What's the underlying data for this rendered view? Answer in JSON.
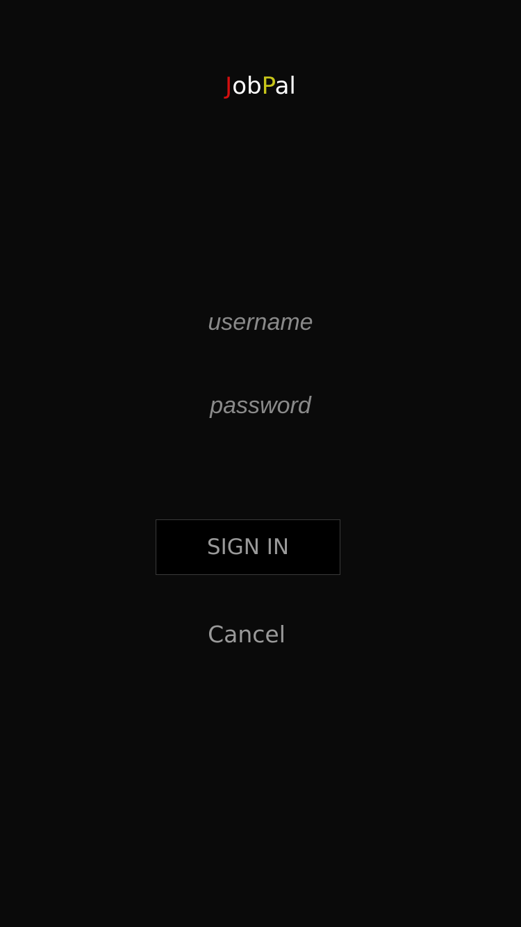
{
  "logo": {
    "letter_j": "J",
    "part_ob": "ob",
    "letter_p": "P",
    "part_al": "al",
    "colors": {
      "j": "#d40f0f",
      "p": "#c7c51a",
      "rest": "#ffffff"
    }
  },
  "form": {
    "username_placeholder": "username",
    "username_value": "",
    "password_placeholder": "password",
    "password_value": ""
  },
  "actions": {
    "sign_in_label": "SIGN IN",
    "cancel_label": "Cancel"
  },
  "theme": {
    "background": "#0a0a0a",
    "button_background": "#000000",
    "muted_text": "#9a9a9a"
  }
}
